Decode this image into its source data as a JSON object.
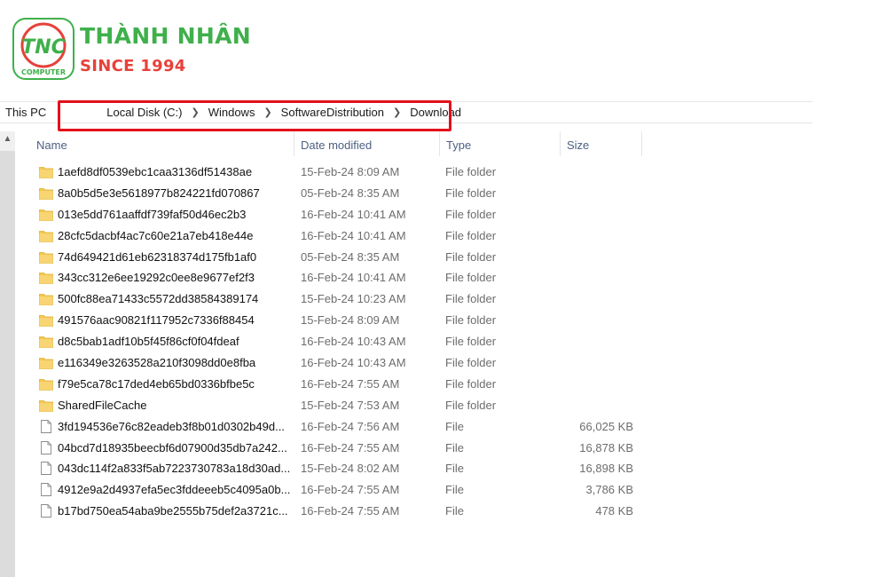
{
  "logo": {
    "badge_text": "TNC",
    "badge_subtext": "COMPUTER",
    "brand_name": "THÀNH NHÂN",
    "since": "SINCE 1994"
  },
  "breadcrumb": [
    "This PC",
    "Local Disk (C:)",
    "Windows",
    "SoftwareDistribution",
    "Download"
  ],
  "columns": {
    "name": "Name",
    "date_modified": "Date modified",
    "type": "Type",
    "size": "Size"
  },
  "colors": {
    "brand_green": "#3fb04b",
    "brand_red": "#e6413a",
    "highlight": "#e3101b",
    "folder": "#f5c74d"
  },
  "items": [
    {
      "name": "1aefd8df0539ebc1caa3136df51438ae",
      "date": "15-Feb-24 8:09 AM",
      "type": "File folder",
      "size": "",
      "icon": "folder-icon"
    },
    {
      "name": "8a0b5d5e3e5618977b824221fd070867",
      "date": "05-Feb-24 8:35 AM",
      "type": "File folder",
      "size": "",
      "icon": "folder-icon"
    },
    {
      "name": "013e5dd761aaffdf739faf50d46ec2b3",
      "date": "16-Feb-24 10:41 AM",
      "type": "File folder",
      "size": "",
      "icon": "folder-icon"
    },
    {
      "name": "28cfc5dacbf4ac7c60e21a7eb418e44e",
      "date": "16-Feb-24 10:41 AM",
      "type": "File folder",
      "size": "",
      "icon": "folder-icon"
    },
    {
      "name": "74d649421d61eb62318374d175fb1af0",
      "date": "05-Feb-24 8:35 AM",
      "type": "File folder",
      "size": "",
      "icon": "folder-icon"
    },
    {
      "name": "343cc312e6ee19292c0ee8e9677ef2f3",
      "date": "16-Feb-24 10:41 AM",
      "type": "File folder",
      "size": "",
      "icon": "folder-icon"
    },
    {
      "name": "500fc88ea71433c5572dd38584389174",
      "date": "15-Feb-24 10:23 AM",
      "type": "File folder",
      "size": "",
      "icon": "folder-icon"
    },
    {
      "name": "491576aac90821f117952c7336f88454",
      "date": "15-Feb-24 8:09 AM",
      "type": "File folder",
      "size": "",
      "icon": "folder-icon"
    },
    {
      "name": "d8c5bab1adf10b5f45f86cf0f04fdeaf",
      "date": "16-Feb-24 10:43 AM",
      "type": "File folder",
      "size": "",
      "icon": "folder-icon"
    },
    {
      "name": "e116349e3263528a210f3098dd0e8fba",
      "date": "16-Feb-24 10:43 AM",
      "type": "File folder",
      "size": "",
      "icon": "folder-icon"
    },
    {
      "name": "f79e5ca78c17ded4eb65bd0336bfbe5c",
      "date": "16-Feb-24 7:55 AM",
      "type": "File folder",
      "size": "",
      "icon": "folder-icon"
    },
    {
      "name": "SharedFileCache",
      "date": "15-Feb-24 7:53 AM",
      "type": "File folder",
      "size": "",
      "icon": "folder-icon"
    },
    {
      "name": "3fd194536e76c82eadeb3f8b01d0302b49d...",
      "date": "16-Feb-24 7:56 AM",
      "type": "File",
      "size": "66,025 KB",
      "icon": "file-icon"
    },
    {
      "name": "04bcd7d18935beecbf6d07900d35db7a242...",
      "date": "16-Feb-24 7:55 AM",
      "type": "File",
      "size": "16,878 KB",
      "icon": "file-icon"
    },
    {
      "name": "043dc114f2a833f5ab7223730783a18d30ad...",
      "date": "15-Feb-24 8:02 AM",
      "type": "File",
      "size": "16,898 KB",
      "icon": "file-icon"
    },
    {
      "name": "4912e9a2d4937efa5ec3fddeeeb5c4095a0b...",
      "date": "16-Feb-24 7:55 AM",
      "type": "File",
      "size": "3,786 KB",
      "icon": "file-icon"
    },
    {
      "name": "b17bd750ea54aba9be2555b75def2a3721c...",
      "date": "16-Feb-24 7:55 AM",
      "type": "File",
      "size": "478 KB",
      "icon": "file-icon"
    }
  ]
}
